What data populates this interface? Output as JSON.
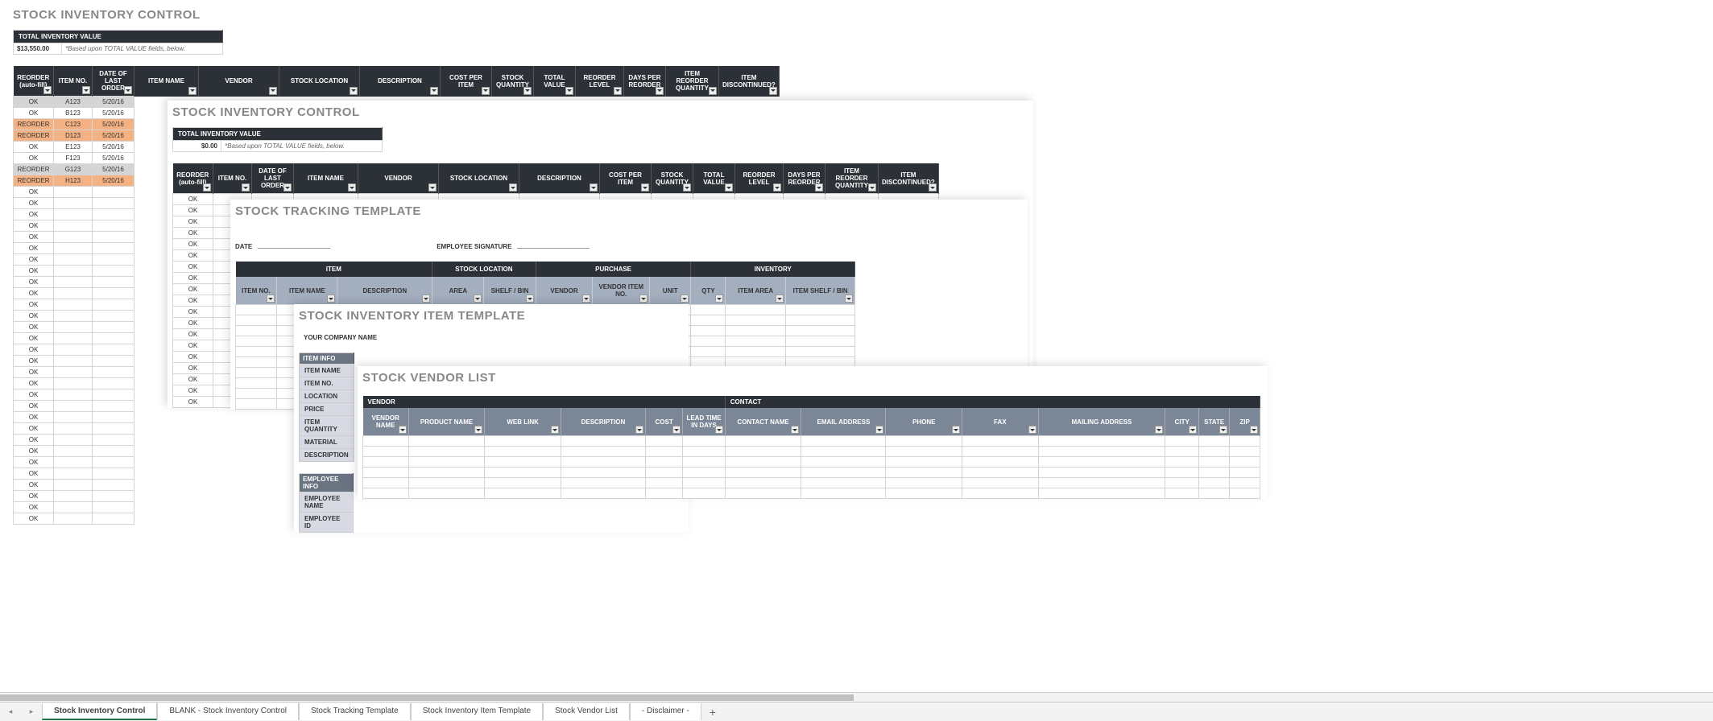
{
  "panel1": {
    "title": "STOCK INVENTORY CONTROL",
    "tiv_label": "TOTAL INVENTORY VALUE",
    "tiv_value": "$13,550.00",
    "tiv_note": "*Based upon TOTAL VALUE fields, below.",
    "cols": [
      "REORDER (auto-fill)",
      "ITEM NO.",
      "DATE OF LAST ORDER",
      "ITEM NAME",
      "VENDOR",
      "STOCK LOCATION",
      "DESCRIPTION",
      "COST PER ITEM",
      "STOCK QUANTITY",
      "TOTAL VALUE",
      "REORDER LEVEL",
      "DAYS PER REORDER",
      "ITEM REORDER QUANTITY",
      "ITEM DISCONTINUED?"
    ],
    "rows": [
      {
        "status": "OK",
        "item": "A123",
        "date": "5/20/16",
        "cls": "row-grey"
      },
      {
        "status": "OK",
        "item": "B123",
        "date": "5/20/16",
        "cls": ""
      },
      {
        "status": "REORDER",
        "item": "C123",
        "date": "5/20/16",
        "cls": "row-orange"
      },
      {
        "status": "REORDER",
        "item": "D123",
        "date": "5/20/16",
        "cls": "row-orange"
      },
      {
        "status": "OK",
        "item": "E123",
        "date": "5/20/16",
        "cls": ""
      },
      {
        "status": "OK",
        "item": "F123",
        "date": "5/20/16",
        "cls": ""
      },
      {
        "status": "REORDER",
        "item": "G123",
        "date": "5/20/16",
        "cls": "row-grey"
      },
      {
        "status": "REORDER",
        "item": "H123",
        "date": "5/20/16",
        "cls": "row-orange"
      }
    ],
    "ok_label": "OK",
    "ok_extra_rows": 30
  },
  "panel2": {
    "title": "STOCK INVENTORY CONTROL",
    "tiv_label": "TOTAL INVENTORY VALUE",
    "tiv_value": "$0.00",
    "tiv_note": "*Based upon TOTAL VALUE fields, below.",
    "cols": [
      "REORDER (auto-fill)",
      "ITEM NO.",
      "DATE OF LAST ORDER",
      "ITEM NAME",
      "VENDOR",
      "STOCK LOCATION",
      "DESCRIPTION",
      "COST PER ITEM",
      "STOCK QUANTITY",
      "TOTAL VALUE",
      "REORDER LEVEL",
      "DAYS PER REORDER",
      "ITEM REORDER QUANTITY",
      "ITEM DISCONTINUED?"
    ],
    "ok_label": "OK",
    "ok_rows": 19
  },
  "panel3": {
    "title": "STOCK TRACKING TEMPLATE",
    "date_label": "DATE",
    "emp_sig_label": "EMPLOYEE SIGNATURE",
    "groups": [
      "ITEM",
      "STOCK LOCATION",
      "PURCHASE",
      "INVENTORY"
    ],
    "cols": [
      "ITEM NO.",
      "ITEM NAME",
      "DESCRIPTION",
      "AREA",
      "SHELF / BIN",
      "VENDOR",
      "VENDOR ITEM NO.",
      "UNIT",
      "QTY",
      "ITEM AREA",
      "ITEM SHELF / BIN"
    ]
  },
  "panel4": {
    "title": "STOCK INVENTORY ITEM TEMPLATE",
    "company_label": "YOUR COMPANY NAME",
    "item_info": "ITEM INFO",
    "item_fields": [
      "ITEM NAME",
      "ITEM NO.",
      "LOCATION",
      "PRICE",
      "ITEM QUANTITY",
      "MATERIAL",
      "DESCRIPTION"
    ],
    "emp_info": "EMPLOYEE INFO",
    "emp_fields": [
      "EMPLOYEE NAME",
      "EMPLOYEE ID"
    ]
  },
  "panel5": {
    "title": "STOCK VENDOR LIST",
    "groups": [
      "VENDOR",
      "CONTACT"
    ],
    "cols": [
      "VENDOR NAME",
      "PRODUCT NAME",
      "WEB LINK",
      "DESCRIPTION",
      "COST",
      "LEAD TIME IN DAYS",
      "CONTACT NAME",
      "EMAIL ADDRESS",
      "PHONE",
      "FAX",
      "MAILING ADDRESS",
      "CITY",
      "STATE",
      "ZIP"
    ]
  },
  "tabs": [
    "Stock Inventory Control",
    "BLANK - Stock Inventory Control",
    "Stock Tracking Template",
    "Stock Inventory Item Template",
    "Stock Vendor List",
    "- Disclaimer -"
  ],
  "add_tab": "+"
}
